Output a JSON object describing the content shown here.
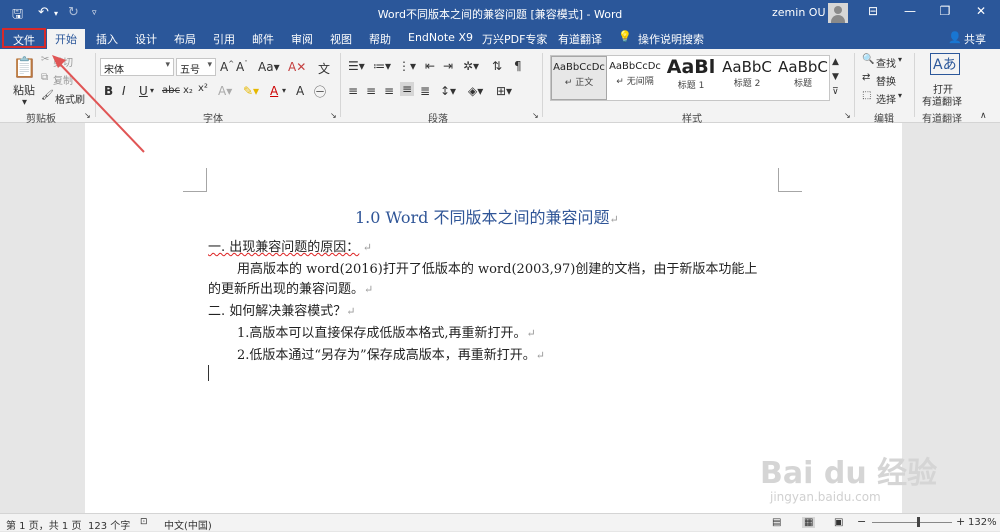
{
  "window": {
    "title": "Word不同版本之间的兼容问题 [兼容模式]  -  Word",
    "user": "zemin OU",
    "share": "共享"
  },
  "tabs": {
    "file": "文件",
    "home": "开始",
    "others": [
      "插入",
      "设计",
      "布局",
      "引用",
      "邮件",
      "审阅",
      "视图",
      "帮助",
      "EndNote X9",
      "万兴PDF专家",
      "有道翻译"
    ],
    "tell_me": "操作说明搜索"
  },
  "ribbon": {
    "clipboard": {
      "label": "剪贴板",
      "paste": "粘贴",
      "cut": "剪切",
      "copy": "复制",
      "format_painter": "格式刷"
    },
    "font": {
      "label": "字体",
      "name": "宋体",
      "size": "五号"
    },
    "paragraph": {
      "label": "段落"
    },
    "styles": {
      "label": "样式",
      "items": [
        {
          "preview": "AaBbCcDc",
          "name": "↵ 正文"
        },
        {
          "preview": "AaBbCcDc",
          "name": "↵ 无间隔"
        },
        {
          "preview": "AaBl",
          "name": "标题 1"
        },
        {
          "preview": "AaBbC",
          "name": "标题 2"
        },
        {
          "preview": "AaBbC",
          "name": "标题"
        }
      ]
    },
    "editing": {
      "label": "编辑",
      "find": "查找",
      "replace": "替换",
      "select": "选择"
    },
    "translate": {
      "label": "有道翻译",
      "open": "打开",
      "open2": "有道翻译"
    }
  },
  "document": {
    "heading": "1.0 Word 不同版本之间的兼容问题",
    "paragraphs": [
      "一. 出现兼容问题的原因：",
      "用高版本的 word(2016)打开了低版本的 word(2003,97)创建的文档，由于新版本功能上",
      "的更新所出现的兼容问题。",
      "二. 如何解决兼容模式？",
      "1.高版本可以直接保存成低版本格式,再重新打开。",
      "2.低版本通过“另存为”保存成高版本，再重新打开。"
    ]
  },
  "status": {
    "page": "第 1 页，共 1 页",
    "words": "123 个字",
    "language": "中文(中国)",
    "zoom": "132%",
    "zoom_level": 0.57
  },
  "watermark": {
    "text": "Bai du 经验",
    "url": "jingyan.baidu.com"
  }
}
